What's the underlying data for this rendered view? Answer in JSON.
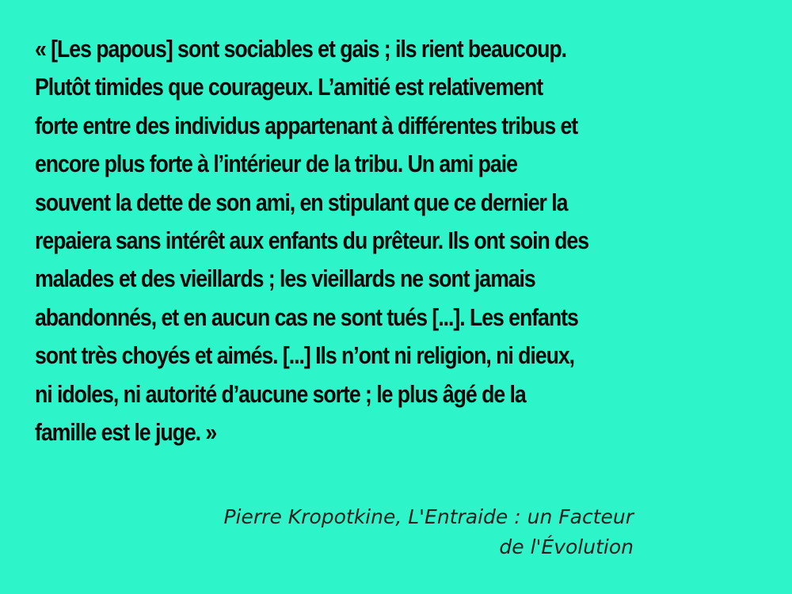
{
  "quote": {
    "lines": [
      "« [Les papous] sont sociables et gais ; ils rient beaucoup.",
      "Plutôt timides que courageux. L’amitié est relativement",
      "forte entre des individus appartenant à différentes tribus et",
      "encore plus forte à l’intérieur de la tribu. Un ami paie",
      "souvent la dette de son ami, en stipulant que ce dernier la",
      "repaiera sans intérêt aux enfants du prêteur. Ils ont soin des",
      "malades et des vieillards ; les vieillards ne sont jamais",
      "abandonnés, et en aucun cas ne sont tués [...]. Les enfants",
      "sont très choyés et aimés. [...] Ils n’ont ni religion, ni dieux,",
      "ni idoles, ni autorité d’aucune sorte ; le plus âgé de la",
      "famille est le juge. »"
    ]
  },
  "attribution": {
    "line1": "Pierre Kropotkine, L'Entraide : un Facteur",
    "line2": "de l'Évolution"
  },
  "colors": {
    "background": "#2ef5c9",
    "text": "#0a0a0a"
  }
}
